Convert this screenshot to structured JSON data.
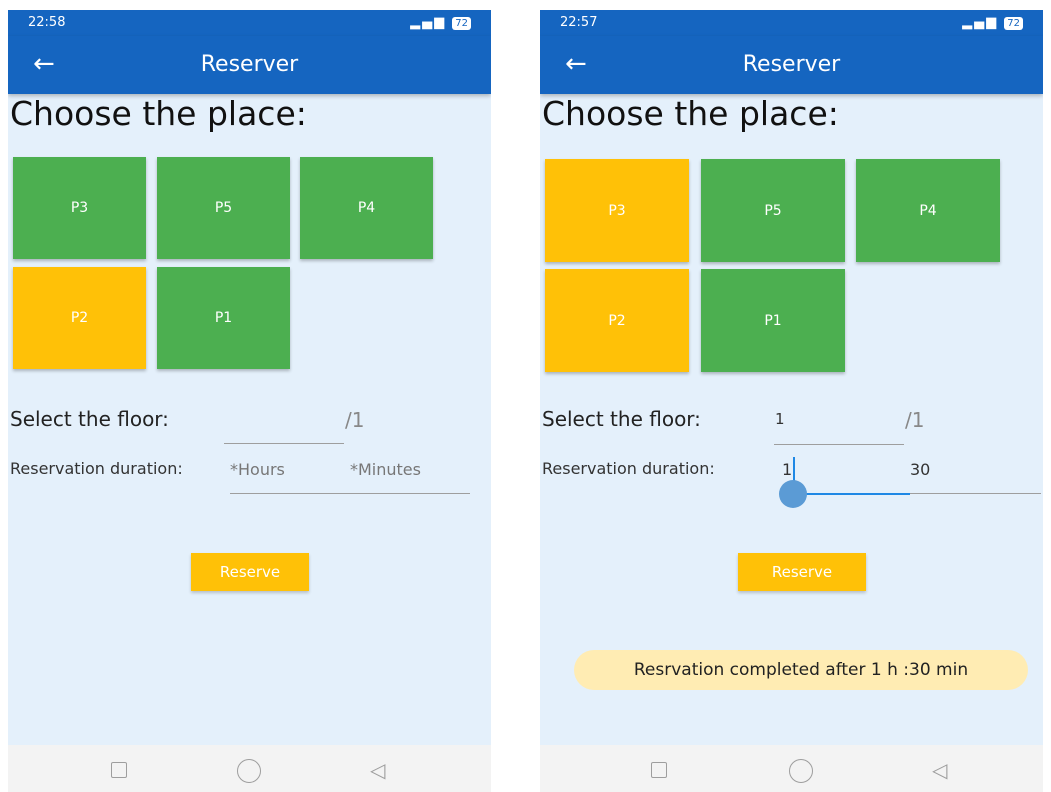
{
  "colors": {
    "primary": "#1565c0",
    "available": "#4caf50",
    "reserved": "#ffc107",
    "background": "#e4f0fb",
    "toast": "#ffecb3"
  },
  "screens": [
    {
      "status": {
        "time": "22:58",
        "battery": "72"
      },
      "app_bar": {
        "back_icon": "arrow-left-icon",
        "title": "Reserver"
      },
      "heading": "Choose the place:",
      "slots": [
        {
          "label": "P3",
          "state": "available"
        },
        {
          "label": "P5",
          "state": "available"
        },
        {
          "label": "P4",
          "state": "available"
        },
        {
          "label": "P2",
          "state": "reserved"
        },
        {
          "label": "P1",
          "state": "available"
        }
      ],
      "floor": {
        "label": "Select the floor:",
        "value": "",
        "suffix": "/1"
      },
      "duration": {
        "label": "Reservation duration:",
        "hours_placeholder": "*Hours",
        "minutes_placeholder": "*Minutes"
      },
      "reserve_label": "Reserve",
      "nav": {
        "recents_icon": "square-icon",
        "home_icon": "circle-icon",
        "back_icon": "triangle-back-icon"
      }
    },
    {
      "status": {
        "time": "22:57",
        "battery": "72"
      },
      "app_bar": {
        "back_icon": "arrow-left-icon",
        "title": "Reserver"
      },
      "heading": "Choose the place:",
      "slots": [
        {
          "label": "P3",
          "state": "reserved"
        },
        {
          "label": "P5",
          "state": "available"
        },
        {
          "label": "P4",
          "state": "available"
        },
        {
          "label": "P2",
          "state": "reserved"
        },
        {
          "label": "P1",
          "state": "available"
        }
      ],
      "floor": {
        "label": "Select the floor:",
        "value": "1",
        "suffix": "/1"
      },
      "duration": {
        "label": "Reservation duration:",
        "hours_value": "1",
        "minutes_value": "30"
      },
      "reserve_label": "Reserve",
      "toast": "Resrvation completed after 1 h :30 min",
      "nav": {
        "recents_icon": "square-icon",
        "home_icon": "circle-icon",
        "back_icon": "triangle-back-icon"
      }
    }
  ]
}
